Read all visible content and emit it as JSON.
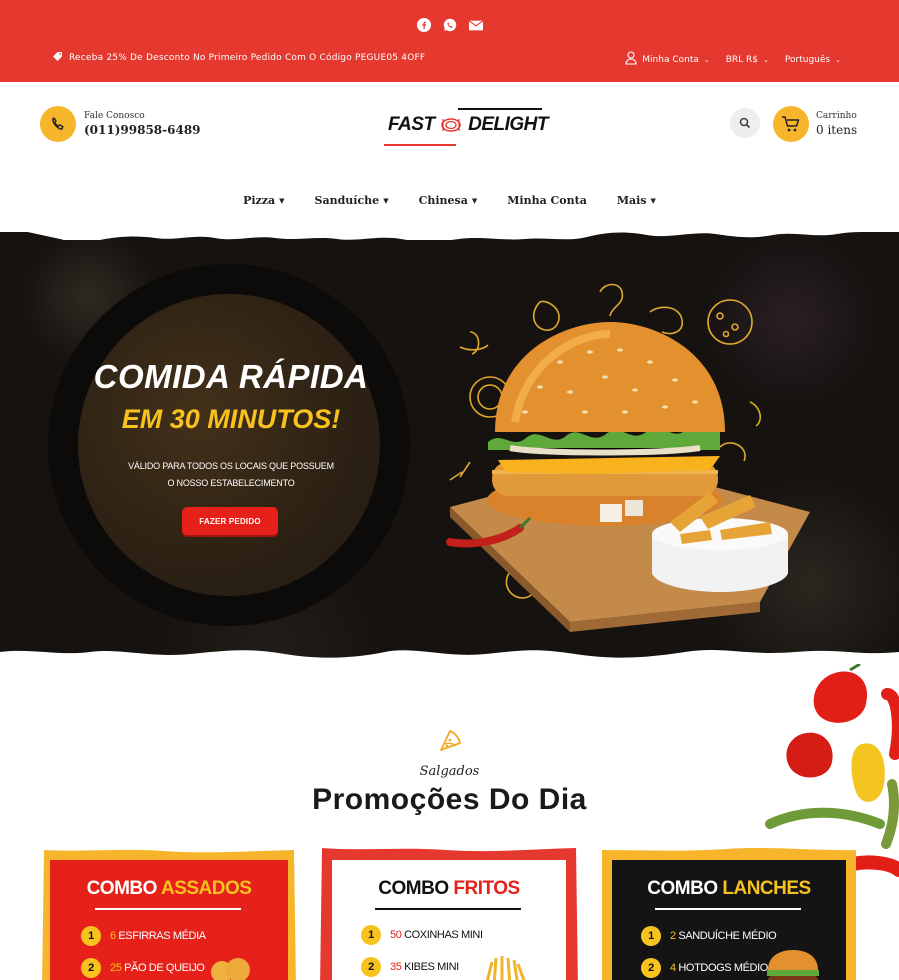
{
  "topbar": {
    "social_icons": [
      "facebook-icon",
      "whatsapp-icon",
      "mail-icon"
    ],
    "promo_text": "Receba 25% De Desconto No Primeiro Pedido Com O Código PEGUE05 4OFF",
    "account_label": "Minha Conta",
    "currency_label": "BRL R$",
    "language_label": "Português"
  },
  "header": {
    "contact_label": "Fale Conosco",
    "contact_phone": "(011)99858-6489",
    "logo_left": "FAST",
    "logo_right": "DELIGHT",
    "cart_label": "Carrinho",
    "cart_count": "0 itens"
  },
  "nav": {
    "items": [
      {
        "label": "Pizza",
        "has_dropdown": true
      },
      {
        "label": "Sanduíche",
        "has_dropdown": true
      },
      {
        "label": "Chinesa",
        "has_dropdown": true
      },
      {
        "label": "Minha Conta",
        "has_dropdown": false
      },
      {
        "label": "Mais",
        "has_dropdown": true
      }
    ]
  },
  "hero": {
    "title": "COMIDA RÁPIDA",
    "subtitle": "EM 30 MINUTOS!",
    "desc_line1": "VÁLIDO PARA TODOS OS LOCAIS QUE POSSUEM",
    "desc_line2": "O NOSSO ESTABELECIMENTO",
    "button": "FAZER PEDIDO"
  },
  "section": {
    "subtitle": "Salgados",
    "title": "Promoções Do Dia"
  },
  "combos": [
    {
      "title_a": "COMBO",
      "title_b": "ASSADOS",
      "items": [
        {
          "n": "1",
          "qty": "6",
          "name": "ESFIRRAS MÉDIA"
        },
        {
          "n": "2",
          "qty": "25",
          "name": "PÃO DE QUEIJO"
        }
      ]
    },
    {
      "title_a": "COMBO",
      "title_b": "FRITOS",
      "items": [
        {
          "n": "1",
          "qty": "50",
          "name": "COXINHAS MINI"
        },
        {
          "n": "2",
          "qty": "35",
          "name": "KIBES MINI"
        }
      ]
    },
    {
      "title_a": "COMBO",
      "title_b": "LANCHES",
      "items": [
        {
          "n": "1",
          "qty": "2",
          "name": "SANDUÍCHE MÉDIO"
        },
        {
          "n": "2",
          "qty": "4",
          "name": "HOTDOGS MÉDIO"
        }
      ]
    }
  ],
  "colors": {
    "brand_red": "#e5382f",
    "accent_yellow": "#f7c21e",
    "orange": "#f7b52c",
    "dark": "#111111"
  }
}
